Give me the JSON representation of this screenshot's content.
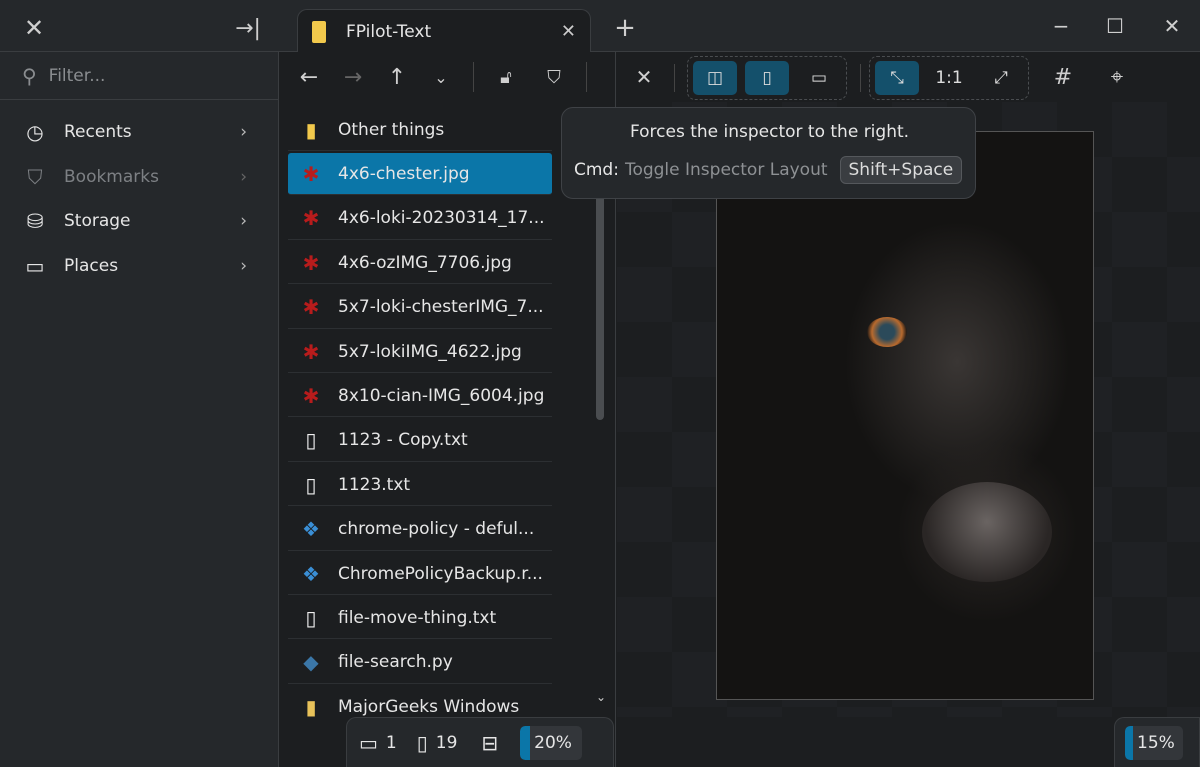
{
  "app": {
    "tab_title": "FPilot-Text",
    "new_tab": "+"
  },
  "window": {
    "minimize": "−",
    "maximize": "☐",
    "close": "✕"
  },
  "sidebar": {
    "filter_placeholder": "Filter...",
    "items": [
      {
        "label": "Recents",
        "icon": "clock-icon"
      },
      {
        "label": "Bookmarks",
        "icon": "bookmark-icon"
      },
      {
        "label": "Storage",
        "icon": "drive-icon"
      },
      {
        "label": "Places",
        "icon": "folder-icon"
      }
    ]
  },
  "files": [
    {
      "name": "Other things",
      "type": "folder"
    },
    {
      "name": "4x6-chester.jpg",
      "type": "image",
      "selected": true
    },
    {
      "name": "4x6-loki-20230314_17...",
      "type": "image"
    },
    {
      "name": "4x6-ozIMG_7706.jpg",
      "type": "image"
    },
    {
      "name": "5x7-loki-chesterIMG_7...",
      "type": "image"
    },
    {
      "name": "5x7-lokiIMG_4622.jpg",
      "type": "image"
    },
    {
      "name": "8x10-cian-IMG_6004.jpg",
      "type": "image"
    },
    {
      "name": "1123 - Copy.txt",
      "type": "text"
    },
    {
      "name": "1123.txt",
      "type": "text"
    },
    {
      "name": "chrome-policy - deful...",
      "type": "reg"
    },
    {
      "name": "ChromePolicyBackup.r...",
      "type": "reg"
    },
    {
      "name": "file-move-thing.txt",
      "type": "text"
    },
    {
      "name": "file-search.py",
      "type": "python"
    },
    {
      "name": "MajorGeeks Windows",
      "type": "zip"
    }
  ],
  "status": {
    "folders": "1",
    "files": "19",
    "list_zoom": "20%",
    "list_zoom_value": 20,
    "preview_zoom": "15%",
    "preview_zoom_value": 15
  },
  "toolbar": {
    "actual_size": "1:1"
  },
  "tooltip": {
    "description": "Forces the inspector to the right.",
    "cmd_label": "Cmd:",
    "cmd_name": "Toggle Inspector Layout",
    "shortcut": "Shift+Space"
  }
}
